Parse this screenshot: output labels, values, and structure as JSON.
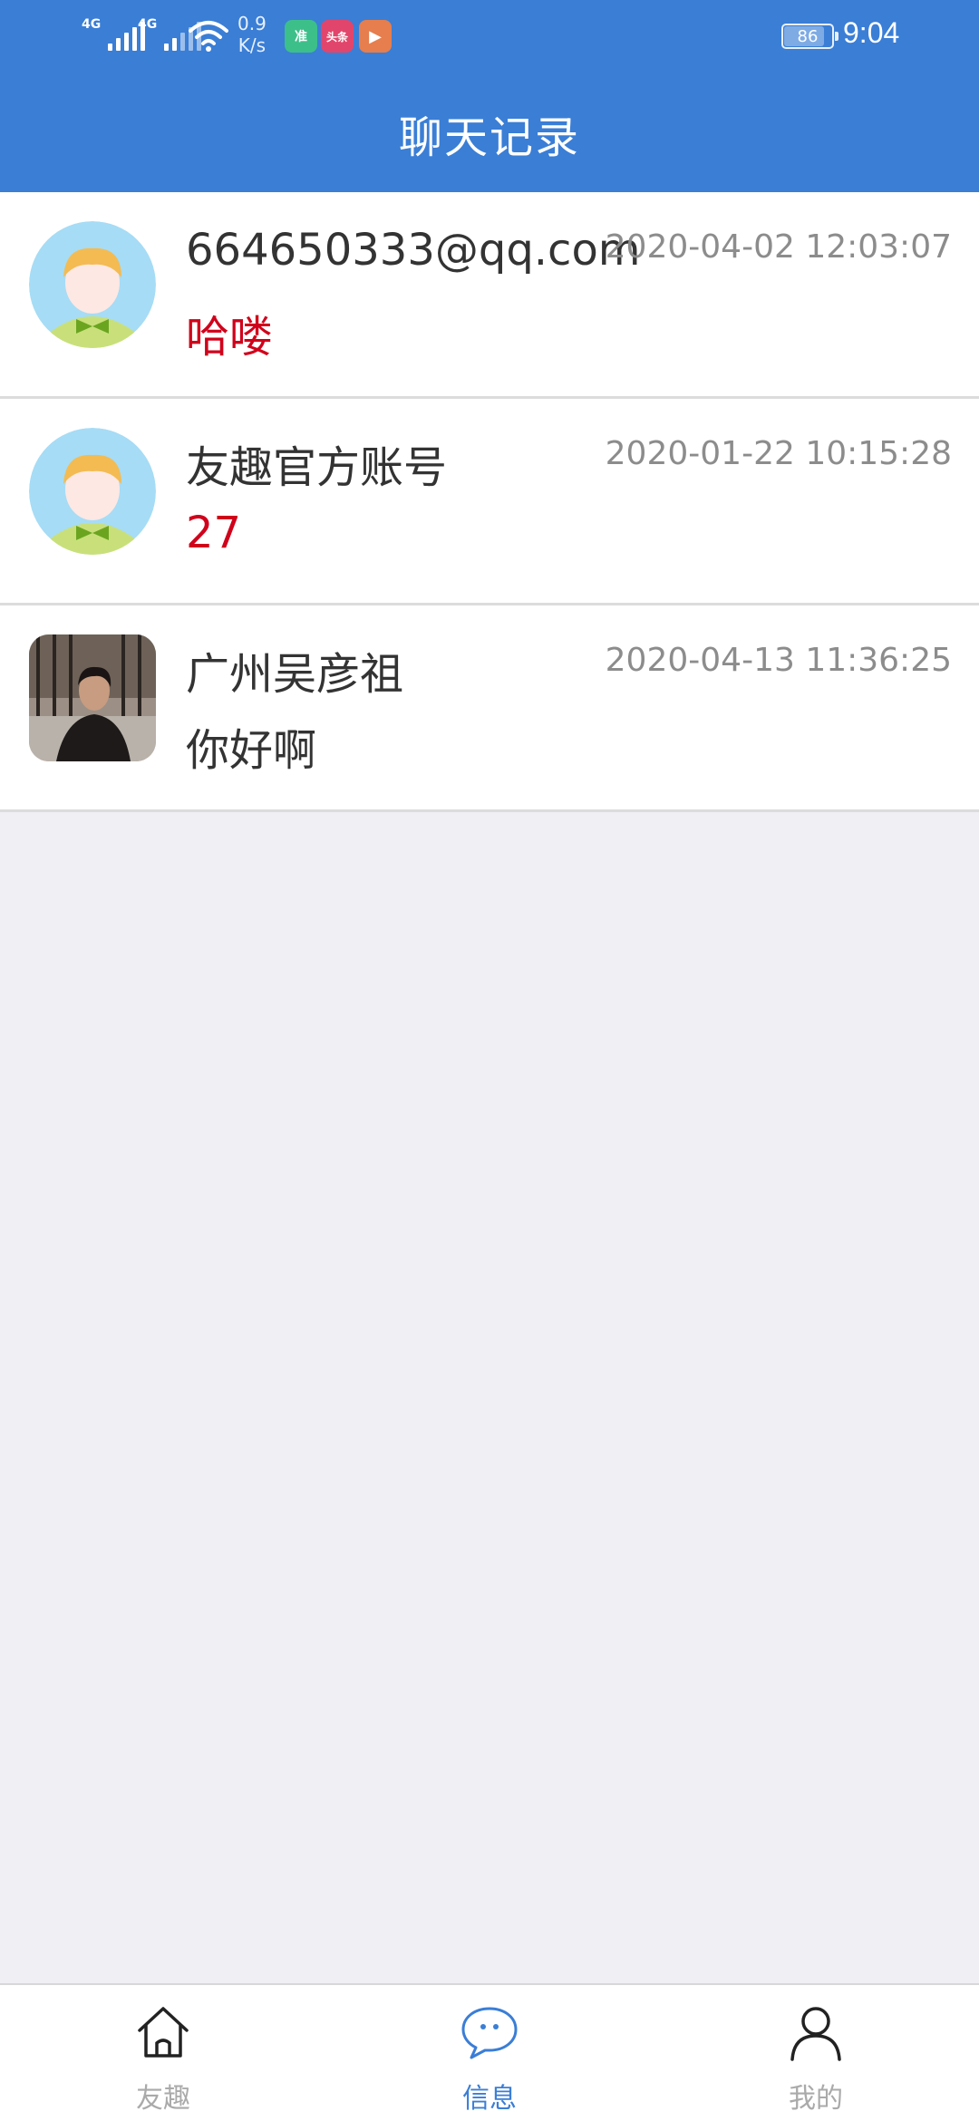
{
  "status_bar": {
    "signal1_label": "4G",
    "signal2_label": "4G",
    "speed_value": "0.9",
    "speed_unit": "K/s",
    "app_icons": [
      {
        "name": "zhun-app-icon",
        "text": "准",
        "color": "#3dbf8a"
      },
      {
        "name": "toutiao-app-icon",
        "text": "头条",
        "color": "#e2456b"
      },
      {
        "name": "video-app-icon",
        "text": "▶",
        "color": "#e67e4d"
      }
    ],
    "battery": "86",
    "time": "9:04"
  },
  "header": {
    "title": "聊天记录"
  },
  "chats": [
    {
      "name": "664650333@qq.com",
      "time": "2020-04-02 12:03:07",
      "message": "哈喽",
      "avatar": "cartoon-boy-avatar",
      "message_color": "red"
    },
    {
      "name": "友趣官方账号",
      "time": "2020-01-22 10:15:28",
      "message": "27",
      "avatar": "cartoon-boy-avatar",
      "message_color": "red"
    },
    {
      "name": "广州吴彦祖",
      "time": "2020-04-13 11:36:25",
      "message": "你好啊",
      "avatar": "user-photo-avatar",
      "message_color": "dark"
    }
  ],
  "bottom_nav": {
    "tabs": [
      {
        "label": "友趣",
        "icon": "home-icon",
        "active": false
      },
      {
        "label": "信息",
        "icon": "chat-bubble-icon",
        "active": true
      },
      {
        "label": "我的",
        "icon": "person-icon",
        "active": false
      }
    ]
  },
  "colors": {
    "primary": "#3a7ed6",
    "unread_message": "#d0021b",
    "background": "#efeff4"
  }
}
